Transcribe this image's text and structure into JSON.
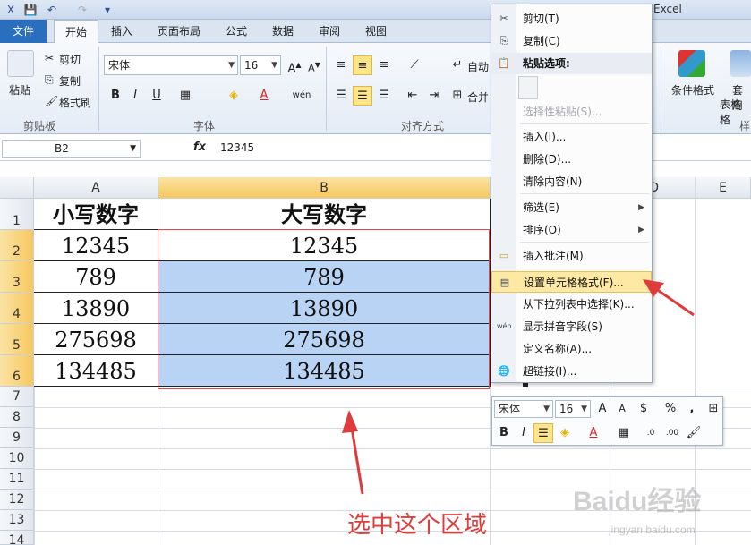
{
  "window": {
    "title": "Excel"
  },
  "quick_access": [
    "save-icon",
    "undo-icon",
    "redo-icon",
    "customize-icon"
  ],
  "tabs": [
    {
      "label": "文件"
    },
    {
      "label": "开始"
    },
    {
      "label": "插入"
    },
    {
      "label": "页面布局"
    },
    {
      "label": "公式"
    },
    {
      "label": "数据"
    },
    {
      "label": "审阅"
    },
    {
      "label": "视图"
    }
  ],
  "ribbon": {
    "clipboard": {
      "paste": "粘贴",
      "cut": "剪切",
      "copy": "复制",
      "format_painter": "格式刷",
      "label": "剪贴板"
    },
    "font": {
      "name": "宋体",
      "size": "16",
      "label": "字体"
    },
    "alignment": {
      "wrap": "自动",
      "merge": "合并",
      "label": "对齐方式"
    },
    "styles": {
      "conditional": "条件格式",
      "table": "套用",
      "table2": "表格格",
      "label": "样"
    }
  },
  "formula_bar": {
    "name_box": "B2",
    "fx": "fx",
    "value": "12345"
  },
  "columns": [
    "A",
    "B",
    "C",
    "D",
    "E"
  ],
  "rows": [
    "1",
    "2",
    "3",
    "4",
    "5",
    "6",
    "7",
    "8",
    "9",
    "10",
    "11",
    "12",
    "13",
    "14"
  ],
  "table": {
    "header_a": "小写数字",
    "header_b": "大写数字",
    "values_a": [
      "12345",
      "789",
      "13890",
      "275698",
      "134485"
    ],
    "values_b": [
      "12345",
      "789",
      "13890",
      "275698",
      "134485"
    ]
  },
  "context_menu": {
    "cut": "剪切(T)",
    "copy": "复制(C)",
    "paste_options": "粘贴选项:",
    "paste_special": "选择性粘贴(S)...",
    "insert": "插入(I)...",
    "delete": "删除(D)...",
    "clear": "清除内容(N)",
    "filter": "筛选(E)",
    "sort": "排序(O)",
    "insert_comment": "插入批注(M)",
    "format_cells": "设置单元格格式(F)...",
    "pick_list": "从下拉列表中选择(K)...",
    "phonetic": "显示拼音字段(S)",
    "define_name": "定义名称(A)...",
    "hyperlink": "超链接(I)..."
  },
  "mini_toolbar": {
    "font": "宋体",
    "size": "16",
    "percent": "%",
    "comma": ","
  },
  "annotation": {
    "text": "选中这个区域",
    "color": "#e03b3b"
  },
  "watermark": {
    "brand": "Baidu经验",
    "url": "jingyan.baidu.com"
  }
}
